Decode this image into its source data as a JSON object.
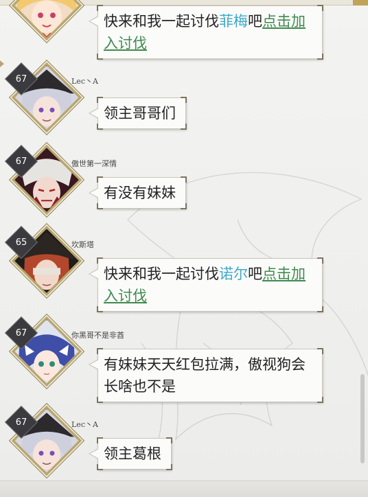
{
  "messages": [
    {
      "id": "m1",
      "level": "",
      "name": "",
      "segments": [
        {
          "text": "快来和我一起讨伐",
          "style": "plain"
        },
        {
          "text": "菲梅",
          "style": "blue"
        },
        {
          "text": "吧",
          "style": "plain"
        },
        {
          "text": "点击加入讨伐",
          "style": "link"
        }
      ]
    },
    {
      "id": "m2",
      "level": "67",
      "name": "Lec丶A",
      "segments": [
        {
          "text": "领主哥哥们",
          "style": "plain"
        }
      ]
    },
    {
      "id": "m3",
      "level": "67",
      "name": "傲世第一深情",
      "segments": [
        {
          "text": "有没有妹妹",
          "style": "plain"
        }
      ]
    },
    {
      "id": "m4",
      "level": "65",
      "name": "坎斯塔",
      "segments": [
        {
          "text": "快来和我一起讨伐",
          "style": "plain"
        },
        {
          "text": "诺尔",
          "style": "blue"
        },
        {
          "text": "吧",
          "style": "plain"
        },
        {
          "text": "点击加入讨伐",
          "style": "link"
        }
      ]
    },
    {
      "id": "m5",
      "level": "67",
      "name": "你黑哥不是非酋",
      "segments": [
        {
          "text": "有妹妹天天红包拉满，傲视狗会长啥也不是",
          "style": "plain"
        }
      ]
    },
    {
      "id": "m6",
      "level": "67",
      "name": "Lec丶A",
      "segments": [
        {
          "text": "领主葛根",
          "style": "plain"
        }
      ]
    }
  ],
  "colors": {
    "highlight_blue": "#3da9c9",
    "link_green": "#3e8a4e",
    "frame_gold": "#b9a76c"
  }
}
